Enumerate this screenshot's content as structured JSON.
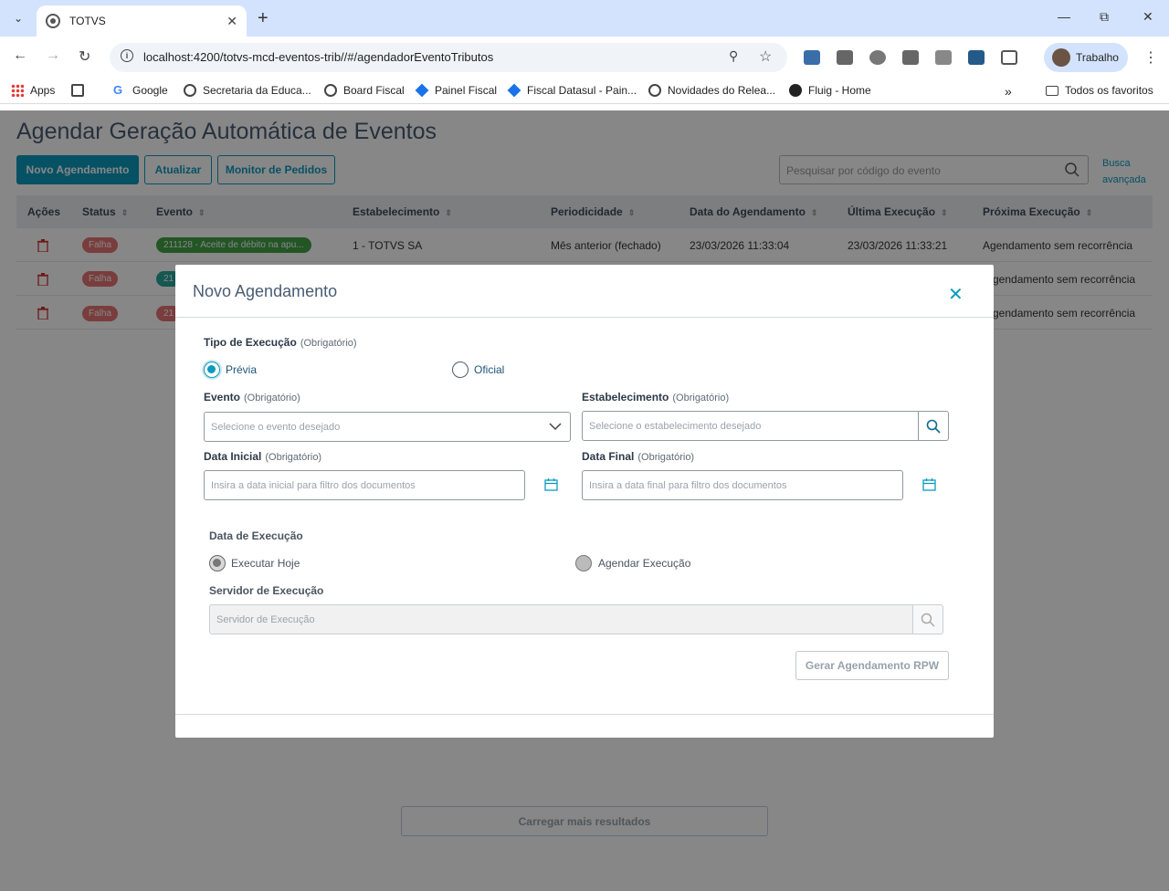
{
  "browser": {
    "tab_title": "TOTVS",
    "url": "localhost:4200/totvs-mcd-eventos-trib//#/agendadorEventoTributos",
    "profile_name": "Trabalho",
    "bookmarks": [
      "Apps",
      "Google",
      "Secretaria da Educa...",
      "Board Fiscal",
      "Painel Fiscal",
      "Fiscal Datasul - Pain...",
      "Novidades do Relea...",
      "Fluig - Home"
    ],
    "all_bookmarks": "Todos os favoritos"
  },
  "page": {
    "title": "Agendar Geração Automática de Eventos",
    "buttons": {
      "new": "Novo Agendamento",
      "refresh": "Atualizar",
      "monitor": "Monitor de Pedidos"
    },
    "search_placeholder": "Pesquisar por código do evento",
    "advanced_search": [
      "Busca",
      "avançada"
    ],
    "columns": [
      "Ações",
      "Status",
      "Evento",
      "Estabelecimento",
      "Periodicidade",
      "Data do Agendamento",
      "Última Execução",
      "Próxima Execução"
    ],
    "rows": [
      {
        "status": "Falha",
        "event": "211128 - Aceite de débito na apu...",
        "establishment": "1 - TOTVS SA",
        "periodicity": "Mês anterior (fechado)",
        "scheduled": "23/03/2026 11:33:04",
        "last_run": "23/03/2026 11:33:21",
        "next_run": "Agendamento sem recorrência"
      },
      {
        "status": "Falha",
        "event": "21",
        "next_run": "gendamento sem recorrência"
      },
      {
        "status": "Falha",
        "event": "21",
        "next_run": "gendamento sem recorrência"
      }
    ],
    "load_more": "Carregar mais resultados"
  },
  "modal": {
    "title": "Novo Agendamento",
    "required": "(Obrigatório)",
    "exec_type_label": "Tipo de Execução",
    "exec_type_options": [
      "Prévia",
      "Oficial"
    ],
    "event_label": "Evento",
    "event_placeholder": "Selecione o evento desejado",
    "establishment_label": "Estabelecimento",
    "establishment_placeholder": "Selecione o estabelecimento desejado",
    "start_date_label": "Data Inicial",
    "start_date_placeholder": "Insira a data inicial para filtro dos documentos",
    "end_date_label": "Data Final",
    "end_date_placeholder": "Insira a data final para filtro dos documentos",
    "exec_date_label": "Data de Execução",
    "exec_date_options": [
      "Executar Hoje",
      "Agendar Execução"
    ],
    "server_label": "Servidor de Execução",
    "server_placeholder": "Servidor de Execução",
    "generate_button": "Gerar Agendamento RPW"
  }
}
